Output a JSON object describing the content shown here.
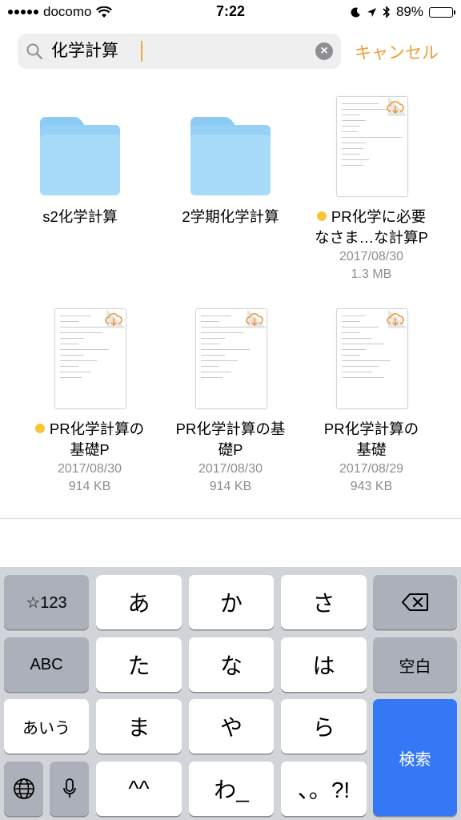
{
  "status_bar": {
    "carrier": "docomo",
    "time": "7:22",
    "battery": "89%",
    "battery_level": 0.89
  },
  "search": {
    "query": "化学計算",
    "cancel_label": "キャンセル"
  },
  "results": [
    {
      "type": "folder",
      "name": "s2化学計算"
    },
    {
      "type": "folder",
      "name": "2学期化学計算"
    },
    {
      "type": "document",
      "name_line1": "PR化学に必要",
      "name_line2": "なさま…な計算P",
      "date": "2017/08/30",
      "size": "1.3 MB",
      "tagged": true
    },
    {
      "type": "document",
      "name_line1": "PR化学計算の",
      "name_line2": "基礎P",
      "date": "2017/08/30",
      "size": "914 KB",
      "tagged": true
    },
    {
      "type": "document",
      "name_line1": "PR化学計算の基",
      "name_line2": "礎P",
      "date": "2017/08/30",
      "size": "914 KB",
      "tagged": false
    },
    {
      "type": "document",
      "name_line1": "PR化学計算の",
      "name_line2": "基礎",
      "date": "2017/08/29",
      "size": "943 KB",
      "tagged": false
    }
  ],
  "keyboard": {
    "symbols": "☆123",
    "a": "あ",
    "ka": "か",
    "sa": "さ",
    "abc": "ABC",
    "ta": "た",
    "na": "な",
    "ha": "は",
    "space": "空白",
    "kana": "あいう",
    "ma": "ま",
    "ya": "や",
    "ra": "ら",
    "search": "検索",
    "emoticon": "^^",
    "wa": "わ_",
    "punct": "、。?!"
  },
  "colors": {
    "accent": "#f09a35",
    "tag": "#f6c533",
    "folder": "#96d0f6",
    "search_key": "#3478f6"
  }
}
